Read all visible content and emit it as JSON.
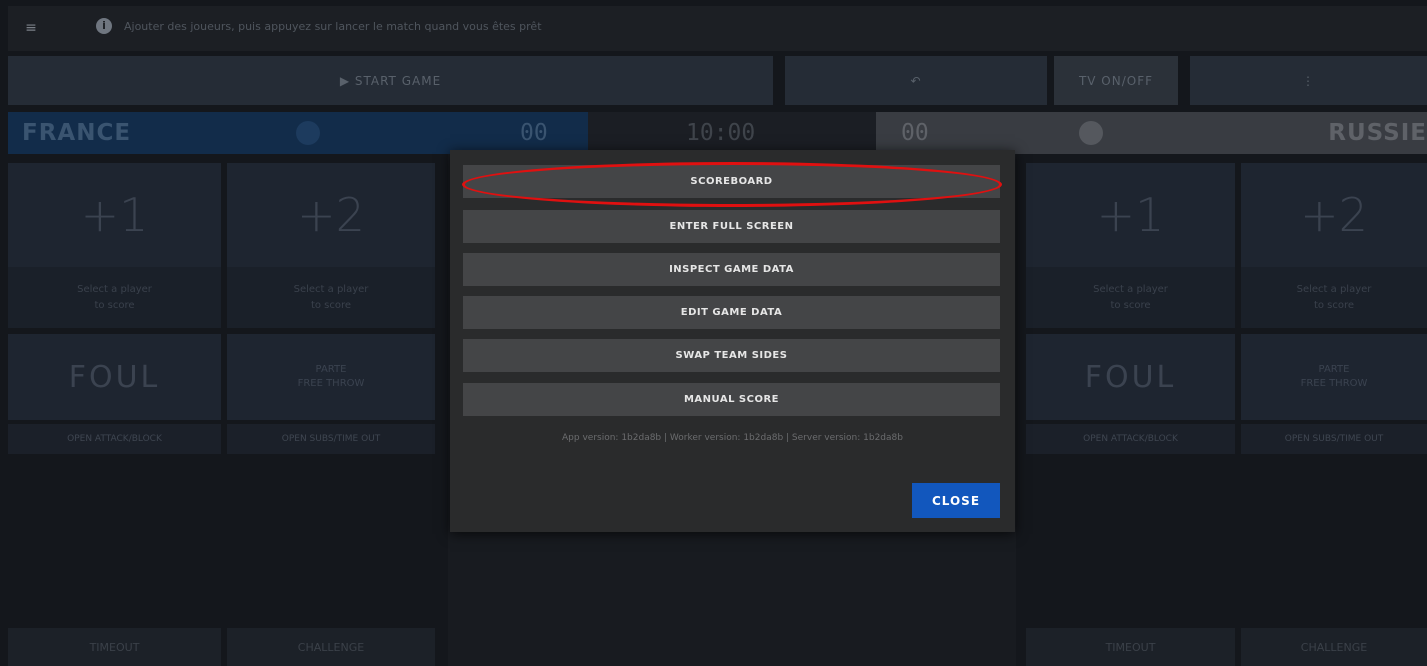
{
  "info_bar": {
    "menu_icon": "≡",
    "info_icon_glyph": "i",
    "message": "Ajouter des joueurs, puis appuyez sur lancer le match quand vous êtes prêt"
  },
  "controls": {
    "start_label": "▶ START GAME",
    "rewind_label": "↶",
    "tv_label": "TV ON/OFF",
    "more_label": "⋮"
  },
  "teams": {
    "left": {
      "name": "FRANCE",
      "score": "00",
      "ball_icon": "basketball-icon",
      "color": "#122c4a"
    },
    "right": {
      "name": "RUSSIE",
      "score": "00",
      "ball_icon": "basketball-icon",
      "color": "#393c42"
    }
  },
  "clock": "10:00",
  "tiles": {
    "plus1": "+1",
    "plus2": "+2",
    "foul": "FOUL",
    "free_throw": "PARTE\nFREE THROW",
    "select_player": "Select a player\nto score",
    "caption_left": "OPEN ATTACK/BLOCK",
    "caption_right": "OPEN SUBS/TIME OUT",
    "bottom_left": "TIMEOUT",
    "bottom_right": "CHALLENGE"
  },
  "modal": {
    "buttons": [
      {
        "id": "scoreboard",
        "label": "SCOREBOARD"
      },
      {
        "id": "fullscreen",
        "label": "ENTER FULL SCREEN"
      },
      {
        "id": "inspect",
        "label": "INSPECT GAME DATA"
      },
      {
        "id": "edit",
        "label": "EDIT GAME DATA"
      },
      {
        "id": "swap",
        "label": "SWAP TEAM SIDES"
      },
      {
        "id": "manual",
        "label": "MANUAL SCORE"
      }
    ],
    "version_text": "App version: 1b2da8b | Worker version: 1b2da8b | Server version: 1b2da8b",
    "close_label": "CLOSE",
    "close_color": "#1257bd"
  },
  "annotation": {
    "highlight_color": "#e01010"
  }
}
